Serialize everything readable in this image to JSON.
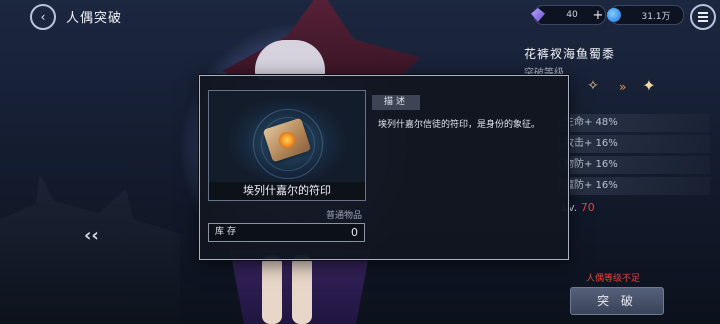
{
  "header": {
    "title": "人偶突破",
    "resources": [
      {
        "icon": "crystal-icon",
        "value": "40"
      },
      {
        "icon": "orb-icon",
        "value": "31.1万"
      }
    ]
  },
  "panel": {
    "puppet_name": "花裤衩海鱼蜀黍",
    "break_label": "突破等级",
    "stats": [
      "生命+ 48%",
      "攻击+ 16%",
      "物防+ 16%",
      "魔防+ 16%"
    ],
    "required_level_label": "Lv.",
    "required_level_value": "70",
    "warning": "人偶等级不足",
    "break_button": "突 破"
  },
  "dialog": {
    "item_name": "埃列什嘉尔的符印",
    "item_type": "普通物品",
    "stock_label": "库存",
    "stock_value": "0",
    "desc_tag": "描述",
    "desc_text": "埃列什嘉尔信徒的符印，是身份的象征。"
  },
  "colors": {
    "warning": "#e0463e",
    "level_value": "#e0463e",
    "dialog_border": "#aab3c4"
  }
}
